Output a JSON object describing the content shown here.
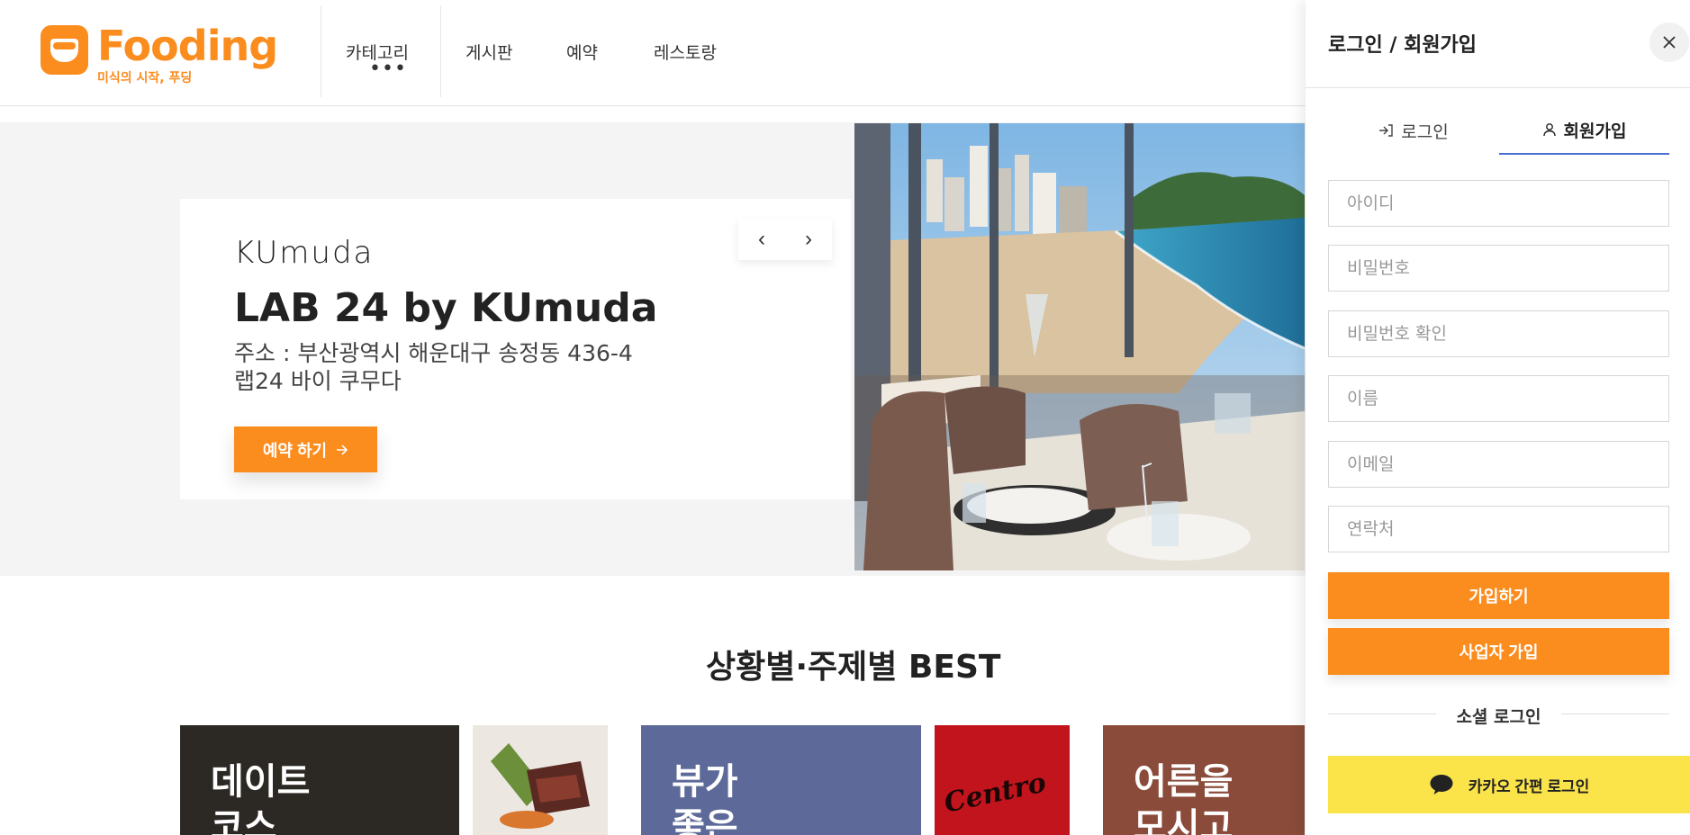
{
  "header": {
    "logo_name": "Fooding",
    "logo_tagline": "미식의 시작, 푸딩",
    "nav": [
      "카테고리",
      "게시판",
      "예약",
      "레스토랑"
    ],
    "nav_more": "•••"
  },
  "hero": {
    "brand_logo": "KUmuda",
    "title": "LAB 24 by KUmuda",
    "address_line1": "주소 : 부산광역시 해운대구 송정동 436-4",
    "address_line2": "랩24 바이 쿠무다",
    "reserve_label": "예약 하기",
    "prev_arrow": "‹",
    "next_arrow": "›"
  },
  "best": {
    "title": "상황별·주제별 BEST",
    "cards": [
      {
        "label_line1": "데이트",
        "label_line2": "코스"
      },
      {
        "label_line1": "뷰가",
        "label_line2": "좋은"
      },
      {
        "label_line1": "어른을",
        "label_line2": "모시고"
      }
    ],
    "sign_text": "Centro"
  },
  "drawer": {
    "title": "로그인 / 회원가입",
    "tabs": [
      {
        "label": "로그인",
        "icon": "login-icon",
        "active": false
      },
      {
        "label": "회원가입",
        "icon": "user-icon",
        "active": true
      }
    ],
    "fields": {
      "username": "아이디",
      "password": "비밀번호",
      "password_confirm": "비밀번호 확인",
      "name": "이름",
      "email": "이메일",
      "phone": "연락처"
    },
    "signup_label": "가입하기",
    "business_signup_label": "사업자 가입",
    "social_label": "소셜 로그인",
    "kakao_label": "카카오 간편 로그인"
  },
  "colors": {
    "accent": "#fb8c1e",
    "tab_underline": "#4a6fd8",
    "kakao": "#fbe34a"
  }
}
